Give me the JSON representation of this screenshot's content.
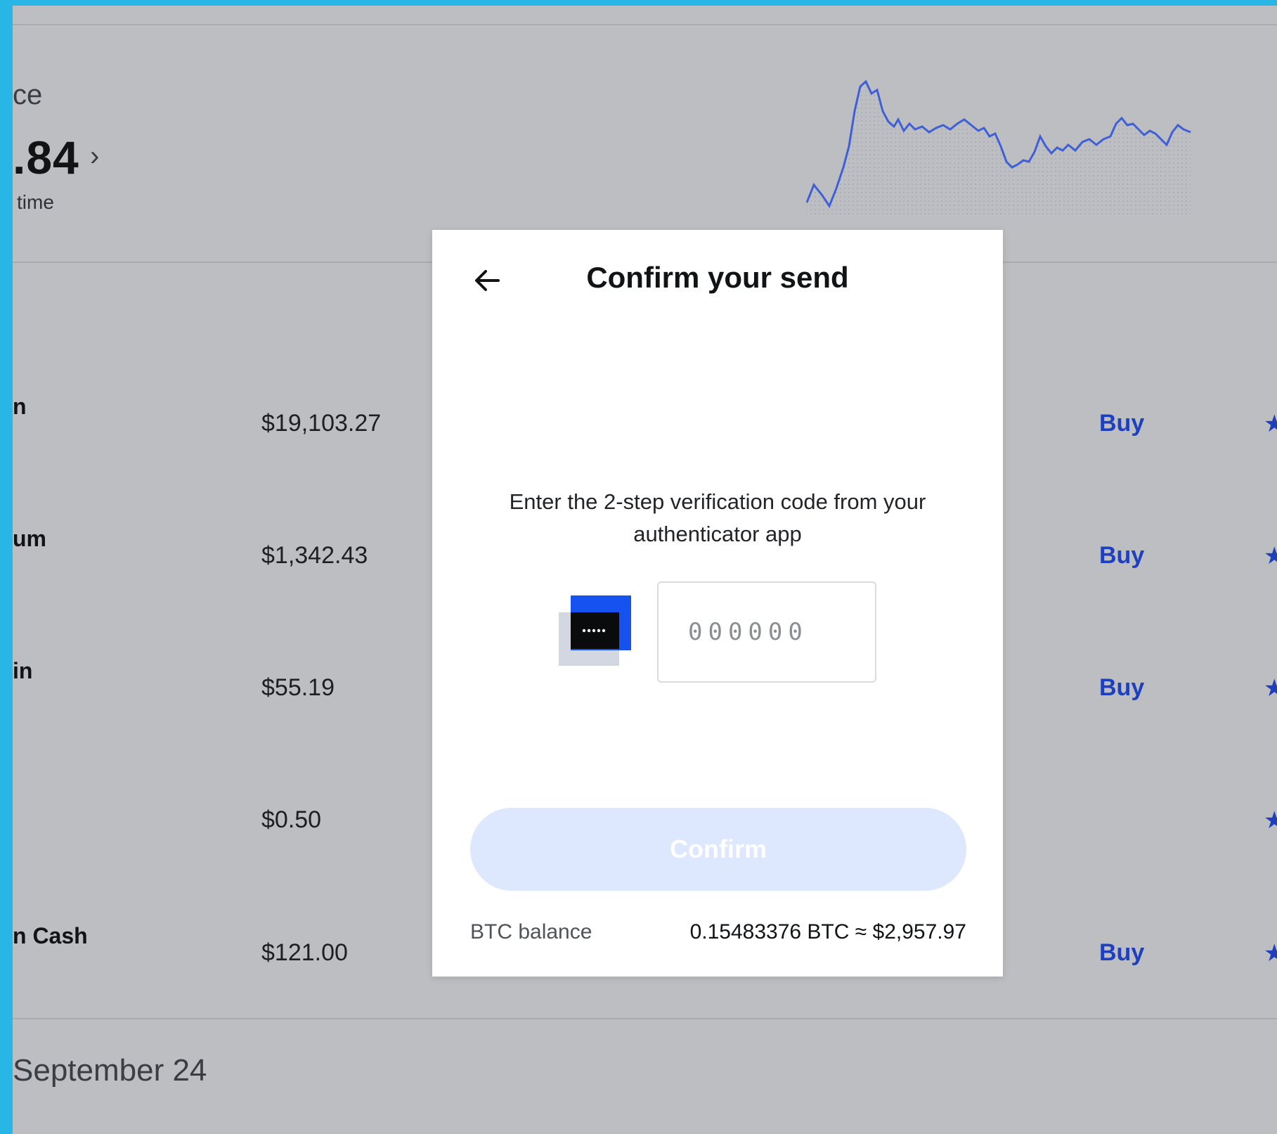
{
  "portfolio": {
    "balance_title": "ce",
    "balance_value": ".84",
    "chevron": "›",
    "balance_sub": "time"
  },
  "assets": [
    {
      "name": "n",
      "price": "$19,103.27",
      "buy": "Buy",
      "star": "★"
    },
    {
      "name": "um",
      "price": "$1,342.43",
      "buy": "Buy",
      "star": "★"
    },
    {
      "name": "in",
      "price": "$55.19",
      "buy": "Buy",
      "star": "★"
    },
    {
      "name": "",
      "price": "$0.50",
      "buy": "",
      "star": "★"
    },
    {
      "name": "n Cash",
      "price": "$121.00",
      "buy": "Buy",
      "star": "★"
    }
  ],
  "date_group": "September 24",
  "modal": {
    "title": "Confirm your send",
    "back_icon": "arrow-left-icon",
    "instruction": "Enter the 2-step verification code from your authenticator app",
    "auth_icon": "authenticator-app-icon",
    "code_placeholder": "000000",
    "code_value": "",
    "confirm_label": "Confirm",
    "balance_label": "BTC balance",
    "balance_amount": "0.15483376 BTC ≈ $2,957.97"
  },
  "colors": {
    "accent": "#1652f0",
    "link": "#1e3fbe",
    "confirm_disabled_bg": "#dde7fe",
    "overlay_bg": "#bcbec2",
    "frame": "#28b6e6"
  }
}
